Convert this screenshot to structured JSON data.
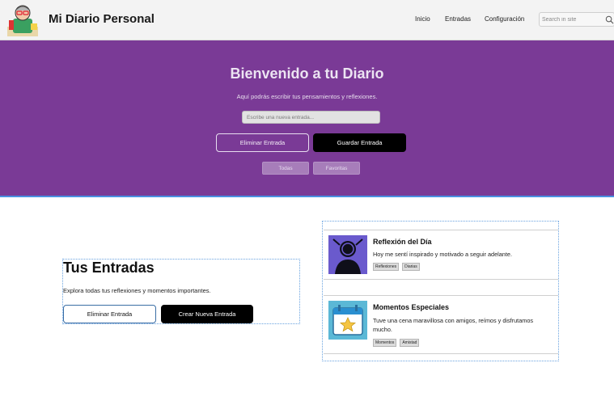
{
  "header": {
    "site_title": "Mi Diario Personal",
    "nav": [
      "Inicio",
      "Entradas",
      "Configuración"
    ],
    "search_placeholder": "Search in site",
    "logo_icon": "diary-writer-logo-icon",
    "search_icon": "search-icon"
  },
  "hero": {
    "title": "Bienvenido a tu Diario",
    "subtitle": "Aquí podrás escribir tus pensamientos y reflexiones.",
    "input_placeholder": "Escribe una nueva entrada...",
    "delete_label": "Eliminar Entrada",
    "save_label": "Guardar Entrada",
    "filters": [
      "Todas",
      "Favoritas"
    ],
    "background_color": "#7a3a96"
  },
  "main": {
    "title": "Tus Entradas",
    "subtitle": "Explora todas tus reflexiones y momentos importantes.",
    "delete_label": "Eliminar Entrada",
    "create_label": "Crear Nueva Entrada"
  },
  "entries": [
    {
      "title": "Reflexión del Día",
      "text": "Hoy me sentí inspirado y motivado a seguir adelante.",
      "tags": [
        "Reflexiones",
        "Diarias"
      ],
      "icon": "person-silhouette-icon"
    },
    {
      "title": "Momentos Especiales",
      "text": "Tuve una cena maravillosa con amigos, reímos y disfrutamos mucho.",
      "tags": [
        "Momentos",
        "Amistad"
      ],
      "icon": "calendar-star-icon"
    }
  ]
}
